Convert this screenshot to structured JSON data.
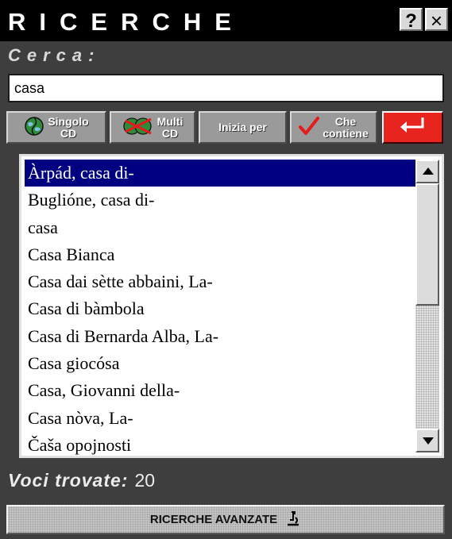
{
  "window": {
    "title": "RICERCHE",
    "help_label": "?",
    "close_label": "×"
  },
  "search": {
    "label": "Cerca:",
    "value": "casa"
  },
  "modes": {
    "single_cd": "Singolo CD",
    "multi_cd": "Multi CD",
    "starts_with": "Inizia per",
    "contains": "Che contiene",
    "enter_icon": "enter-arrow-icon"
  },
  "results": {
    "items": [
      "Àrpád, casa di-",
      "Buglióne, casa di-",
      "casa",
      "Casa Bianca",
      "Casa dai sètte abbaini, La-",
      "Casa di bàmbola",
      "Casa di Bernarda Alba, La-",
      "Casa giocósa",
      "Casa, Giovanni della-",
      "Casa nòva, La-",
      "Čaša opojnosti"
    ],
    "selected_index": 0
  },
  "footer": {
    "found_label": "Voci trovate:",
    "found_count": "20",
    "advanced_label": "RICERCHE AVANZATE"
  },
  "colors": {
    "panel": "#3e3e3e",
    "selection": "#000080",
    "enter_button": "#e8241f"
  }
}
